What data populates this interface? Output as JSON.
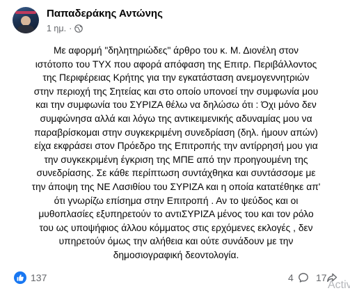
{
  "post": {
    "author": "Παπαδεράκης Αντώνης",
    "time": "1 ημ.",
    "separator": "·",
    "privacy_icon": "globe-icon",
    "body": "Με αφορμή \"δηλητηριώδες\" άρθρο του κ. Μ. Διονέλη  στον\nιστότοπο του ΤΥΧ που αφορά απόφαση της Επιτρ. Περιβάλλοντος\nτης Περιφέρειας Κρήτης για την εγκατάσταση ανεμογεννητριών\nστην περιοχή της Σητείας και στο οποίο υπονοεί την συμφωνία μου\nκαι την συμφωνία του ΣΥΡΙΖΑ θέλω να δηλώσω ότι : Όχι μόνο δεν\nσυμφώνησα αλλά και λόγω της αντικειμενικής αδυναμίας μου να\nπαραβρίσκομαι στην συγκεκριμένη συνεδρίαση (δηλ. ήμουν απών)\nείχα εκφράσει στον Πρόεδρο της Επιτροπής την αντίρρησή μου για\nτην συγκεκριμένη έγκριση της ΜΠΕ από την προηγουμένη της\nσυνεδρίασης. Σε κάθε περίπτωση συντάχθηκα και συντάσσομε με\nτην άποψη της ΝΕ Λασιθίου του ΣΥΡΙΖΑ και η οποία κατατέθηκε  απ'\nότι γνωρίζω επίσημα στην Επιτροπή . Αν το ψεύδος  και οι\nμυθοπλασίες  εξυπηρετούν το αντιΣΥΡΙΖΑ μένος του και τον ρόλο\nτου ως υποψήφιος άλλου κόμματος στις ερχόμενες εκλογές , δεν\nυπηρετούν  όμως την αλήθεια και ούτε συνάδουν με την\nδημοσιογραφική δεοντολογία."
  },
  "footer": {
    "like_icon": "like-thumb-icon",
    "likes": "137",
    "comments": "4",
    "comment_icon": "comment-bubble-icon",
    "shares": "17",
    "share_icon": "share-arrow-icon",
    "watermark": "Activ"
  },
  "colors": {
    "text": "#050505",
    "secondary": "#65676b",
    "like_blue": "#1877f2"
  }
}
